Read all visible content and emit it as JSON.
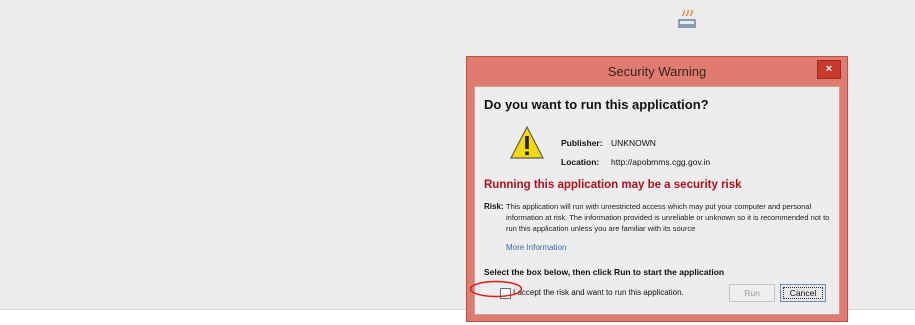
{
  "dialog": {
    "title": "Security Warning",
    "close_label": "×",
    "question": "Do you want to run this application?",
    "publisher_label": "Publisher:",
    "publisher_value": "UNKNOWN",
    "location_label": "Location:",
    "location_value": "http://apobmms.cgg.gov.in",
    "risk_heading": "Running this application may be a security risk",
    "risk_label": "Risk:",
    "risk_text": "This application will run with unrestricted access which may put your computer and personal information at risk. The information provided is unreliable or unknown so it is recommended not to run this application unless you are familiar with its source",
    "more_info": "More Information",
    "instruction": "Select the box below, then click Run to start the application",
    "accept_label": "I accept the risk and want to run this application.",
    "accept_checked": false,
    "run_label": "Run",
    "cancel_label": "Cancel"
  },
  "icons": {
    "java": "java-icon",
    "warning": "warning-icon",
    "close": "close-icon"
  },
  "colors": {
    "title_bar": "#e07b6f",
    "close_button": "#c73a2c",
    "risk_heading": "#b3101b",
    "link": "#3c68b5",
    "annotation": "#e0191b"
  }
}
